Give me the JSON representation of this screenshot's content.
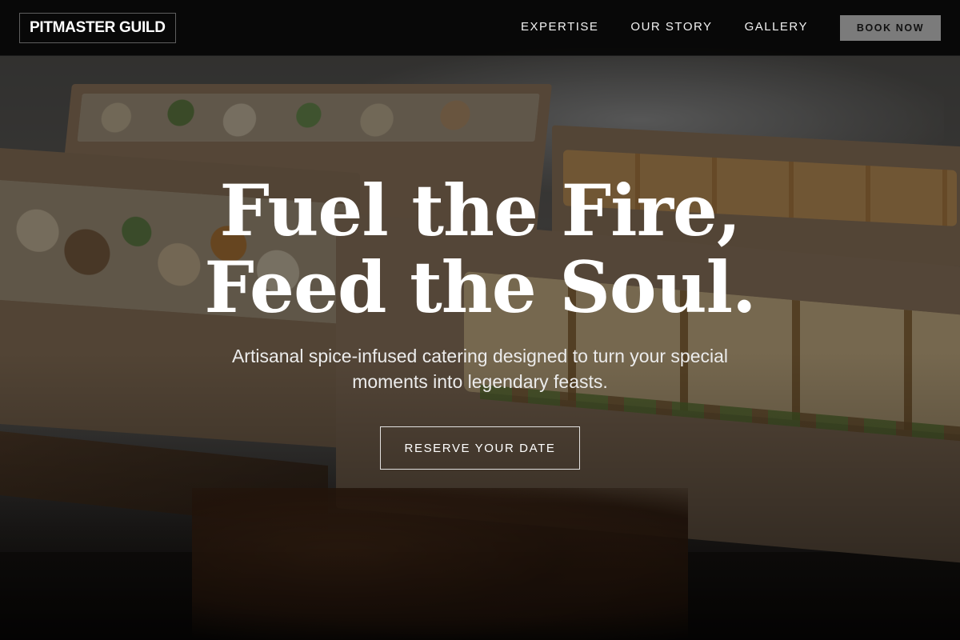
{
  "brand": {
    "logo_text": "PITMASTER GUILD"
  },
  "nav": {
    "links": [
      {
        "label": "EXPERTISE"
      },
      {
        "label": "OUR STORY"
      },
      {
        "label": "GALLERY"
      }
    ],
    "cta_label": "BOOK NOW"
  },
  "hero": {
    "headline_line1": "Fuel the Fire,",
    "headline_line2": "Feed the Soul.",
    "subtitle": "Artisanal spice-infused catering designed to turn your special moments into legendary feasts.",
    "cta_label": "RESERVE YOUR DATE"
  },
  "colors": {
    "nav_background": "#000000",
    "book_button_background": "#7b7b7b",
    "text": "#ffffff"
  }
}
